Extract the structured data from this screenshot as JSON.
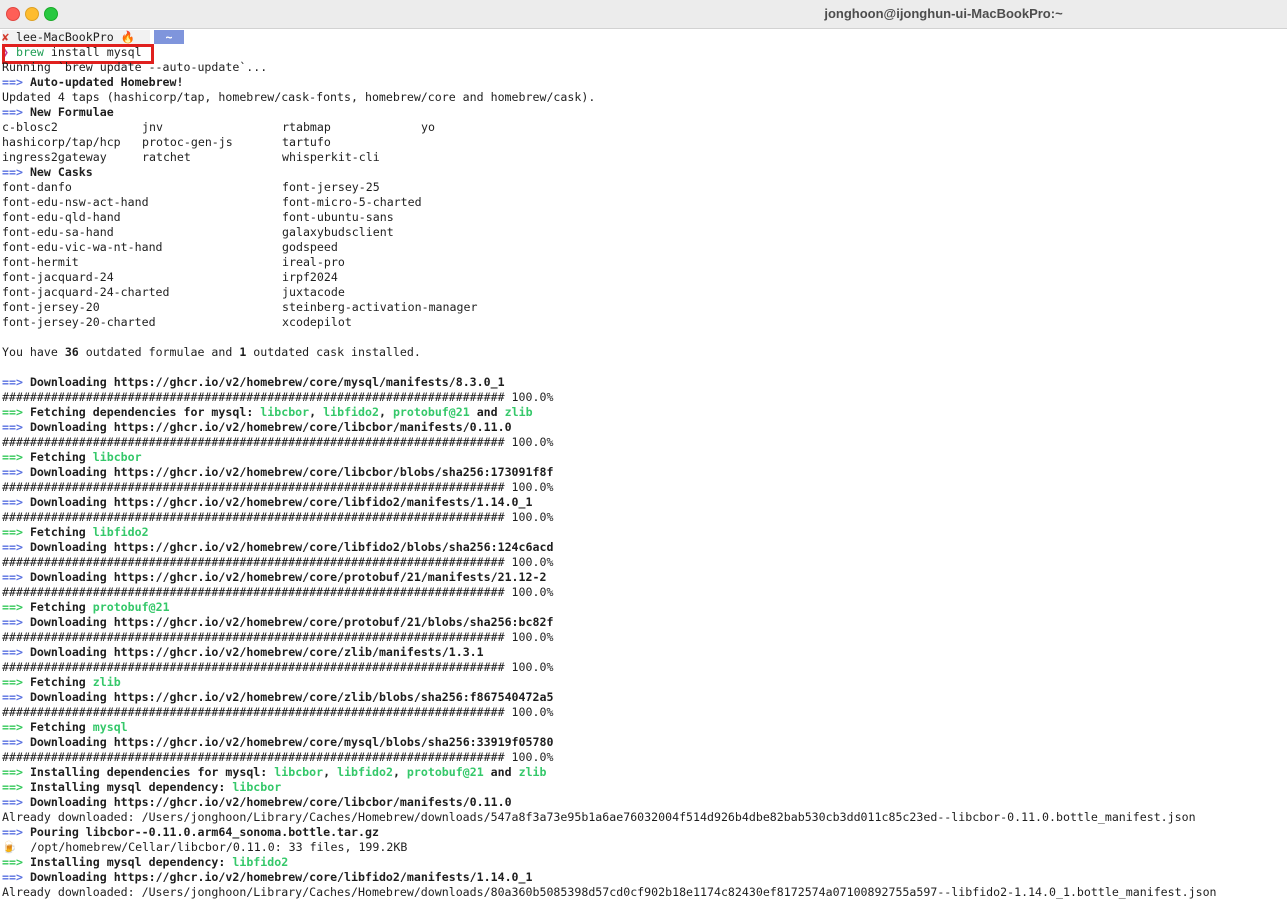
{
  "window": {
    "title": "jonghoon@ijonghun-ui-MacBookPro:~"
  },
  "prompt": {
    "status_icon": "✘",
    "host": "lee-MacBookPro",
    "fire": "🔥",
    "dir": "~"
  },
  "command": {
    "caret": "❯",
    "cmd": "brew",
    "args": " install mysql"
  },
  "lines": {
    "running": "Running `brew update --auto-update`...",
    "auto_updated": "Auto-updated Homebrew!",
    "updated_taps": "Updated 4 taps (hashicorp/tap, homebrew/cask-fonts, homebrew/core and homebrew/cask).",
    "new_formulae": "New Formulae",
    "new_casks": "New Casks",
    "outdated_1": "You have ",
    "outdated_2": "36",
    "outdated_3": " outdated formulae and ",
    "outdated_4": "1",
    "outdated_5": " outdated cask installed.",
    "arrow": "==>"
  },
  "formulae": [
    [
      "c-blosc2",
      "jnv",
      "rtabmap",
      "yo"
    ],
    [
      "hashicorp/tap/hcp",
      "protoc-gen-js",
      "tartufo",
      ""
    ],
    [
      "ingress2gateway",
      "ratchet",
      "whisperkit-cli",
      ""
    ]
  ],
  "casks": [
    [
      "font-danfo",
      "font-jersey-25"
    ],
    [
      "font-edu-nsw-act-hand",
      "font-micro-5-charted"
    ],
    [
      "font-edu-qld-hand",
      "font-ubuntu-sans"
    ],
    [
      "font-edu-sa-hand",
      "galaxybudsclient"
    ],
    [
      "font-edu-vic-wa-nt-hand",
      "godspeed"
    ],
    [
      "font-hermit",
      "ireal-pro"
    ],
    [
      "font-jacquard-24",
      "irpf2024"
    ],
    [
      "font-jacquard-24-charted",
      "juxtacode"
    ],
    [
      "font-jersey-20",
      "steinberg-activation-manager"
    ],
    [
      "font-jersey-20-charted",
      "xcodepilot"
    ]
  ],
  "download_log": [
    {
      "arrow_color": "blue",
      "parts": [
        {
          "t": "Downloading https://ghcr.io/v2/homebrew/core/mysql/manifests/8.3.0_1",
          "s": "b"
        }
      ]
    },
    {
      "progress": "100.0%"
    },
    {
      "arrow_color": "green",
      "parts": [
        {
          "t": "Fetching dependencies for mysql: ",
          "s": "b"
        },
        {
          "t": "libcbor",
          "s": "g"
        },
        {
          "t": ", ",
          "s": "b"
        },
        {
          "t": "libfido2",
          "s": "g"
        },
        {
          "t": ", ",
          "s": "b"
        },
        {
          "t": "protobuf@21",
          "s": "g"
        },
        {
          "t": " and ",
          "s": "b"
        },
        {
          "t": "zlib",
          "s": "g"
        }
      ]
    },
    {
      "arrow_color": "blue",
      "parts": [
        {
          "t": "Downloading https://ghcr.io/v2/homebrew/core/libcbor/manifests/0.11.0",
          "s": "b"
        }
      ]
    },
    {
      "progress": "100.0%"
    },
    {
      "arrow_color": "green",
      "parts": [
        {
          "t": "Fetching ",
          "s": "b"
        },
        {
          "t": "libcbor",
          "s": "g"
        }
      ]
    },
    {
      "arrow_color": "blue",
      "parts": [
        {
          "t": "Downloading https://ghcr.io/v2/homebrew/core/libcbor/blobs/sha256:173091f8f",
          "s": "b"
        }
      ]
    },
    {
      "progress": "100.0%"
    },
    {
      "arrow_color": "blue",
      "parts": [
        {
          "t": "Downloading https://ghcr.io/v2/homebrew/core/libfido2/manifests/1.14.0_1",
          "s": "b"
        }
      ]
    },
    {
      "progress": "100.0%"
    },
    {
      "arrow_color": "green",
      "parts": [
        {
          "t": "Fetching ",
          "s": "b"
        },
        {
          "t": "libfido2",
          "s": "g"
        }
      ]
    },
    {
      "arrow_color": "blue",
      "parts": [
        {
          "t": "Downloading https://ghcr.io/v2/homebrew/core/libfido2/blobs/sha256:124c6acd",
          "s": "b"
        }
      ]
    },
    {
      "progress": "100.0%"
    },
    {
      "arrow_color": "blue",
      "parts": [
        {
          "t": "Downloading https://ghcr.io/v2/homebrew/core/protobuf/21/manifests/21.12-2",
          "s": "b"
        }
      ]
    },
    {
      "progress": "100.0%"
    },
    {
      "arrow_color": "green",
      "parts": [
        {
          "t": "Fetching ",
          "s": "b"
        },
        {
          "t": "protobuf@21",
          "s": "g"
        }
      ]
    },
    {
      "arrow_color": "blue",
      "parts": [
        {
          "t": "Downloading https://ghcr.io/v2/homebrew/core/protobuf/21/blobs/sha256:bc82f",
          "s": "b"
        }
      ]
    },
    {
      "progress": "100.0%"
    },
    {
      "arrow_color": "blue",
      "parts": [
        {
          "t": "Downloading https://ghcr.io/v2/homebrew/core/zlib/manifests/1.3.1",
          "s": "b"
        }
      ]
    },
    {
      "progress": "100.0%"
    },
    {
      "arrow_color": "green",
      "parts": [
        {
          "t": "Fetching ",
          "s": "b"
        },
        {
          "t": "zlib",
          "s": "g"
        }
      ]
    },
    {
      "arrow_color": "blue",
      "parts": [
        {
          "t": "Downloading https://ghcr.io/v2/homebrew/core/zlib/blobs/sha256:f867540472a5",
          "s": "b"
        }
      ]
    },
    {
      "progress": "100.0%"
    },
    {
      "arrow_color": "green",
      "parts": [
        {
          "t": "Fetching ",
          "s": "b"
        },
        {
          "t": "mysql",
          "s": "g"
        }
      ]
    },
    {
      "arrow_color": "blue",
      "parts": [
        {
          "t": "Downloading https://ghcr.io/v2/homebrew/core/mysql/blobs/sha256:33919f05780",
          "s": "b"
        }
      ]
    },
    {
      "progress": "100.0%"
    },
    {
      "arrow_color": "green",
      "parts": [
        {
          "t": "Installing dependencies for mysql: ",
          "s": "b"
        },
        {
          "t": "libcbor",
          "s": "g"
        },
        {
          "t": ", ",
          "s": "b"
        },
        {
          "t": "libfido2",
          "s": "g"
        },
        {
          "t": ", ",
          "s": "b"
        },
        {
          "t": "protobuf@21",
          "s": "g"
        },
        {
          "t": " and ",
          "s": "b"
        },
        {
          "t": "zlib",
          "s": "g"
        }
      ]
    },
    {
      "arrow_color": "green",
      "parts": [
        {
          "t": "Installing mysql dependency: ",
          "s": "b"
        },
        {
          "t": "libcbor",
          "s": "g"
        }
      ]
    },
    {
      "arrow_color": "blue",
      "parts": [
        {
          "t": "Downloading https://ghcr.io/v2/homebrew/core/libcbor/manifests/0.11.0",
          "s": "b"
        }
      ]
    },
    {
      "plain": "Already downloaded: /Users/jonghoon/Library/Caches/Homebrew/downloads/547a8f3a73e95b1a6ae76032004f514d926b4dbe82bab530cb3dd011c85c23ed--libcbor-0.11.0.bottle_manifest.json"
    },
    {
      "arrow_color": "blue",
      "parts": [
        {
          "t": "Pouring libcbor--0.11.0.arm64_sonoma.bottle.tar.gz",
          "s": "b"
        }
      ]
    },
    {
      "plain": "🍺  /opt/homebrew/Cellar/libcbor/0.11.0: 33 files, 199.2KB"
    },
    {
      "arrow_color": "green",
      "parts": [
        {
          "t": "Installing mysql dependency: ",
          "s": "b"
        },
        {
          "t": "libfido2",
          "s": "g"
        }
      ]
    },
    {
      "arrow_color": "blue",
      "parts": [
        {
          "t": "Downloading https://ghcr.io/v2/homebrew/core/libfido2/manifests/1.14.0_1",
          "s": "b"
        }
      ]
    },
    {
      "plain": "Already downloaded: /Users/jonghoon/Library/Caches/Homebrew/downloads/80a360b5085398d57cd0cf902b18e1174c82430ef8172574a07100892755a597--libfido2-1.14.0_1.bottle_manifest.json"
    }
  ],
  "colors": {
    "arrow_blue": "#5870e0",
    "arrow_green": "#33c95a",
    "highlight_green": "#35c86a",
    "annotation_red": "#e0201e"
  }
}
